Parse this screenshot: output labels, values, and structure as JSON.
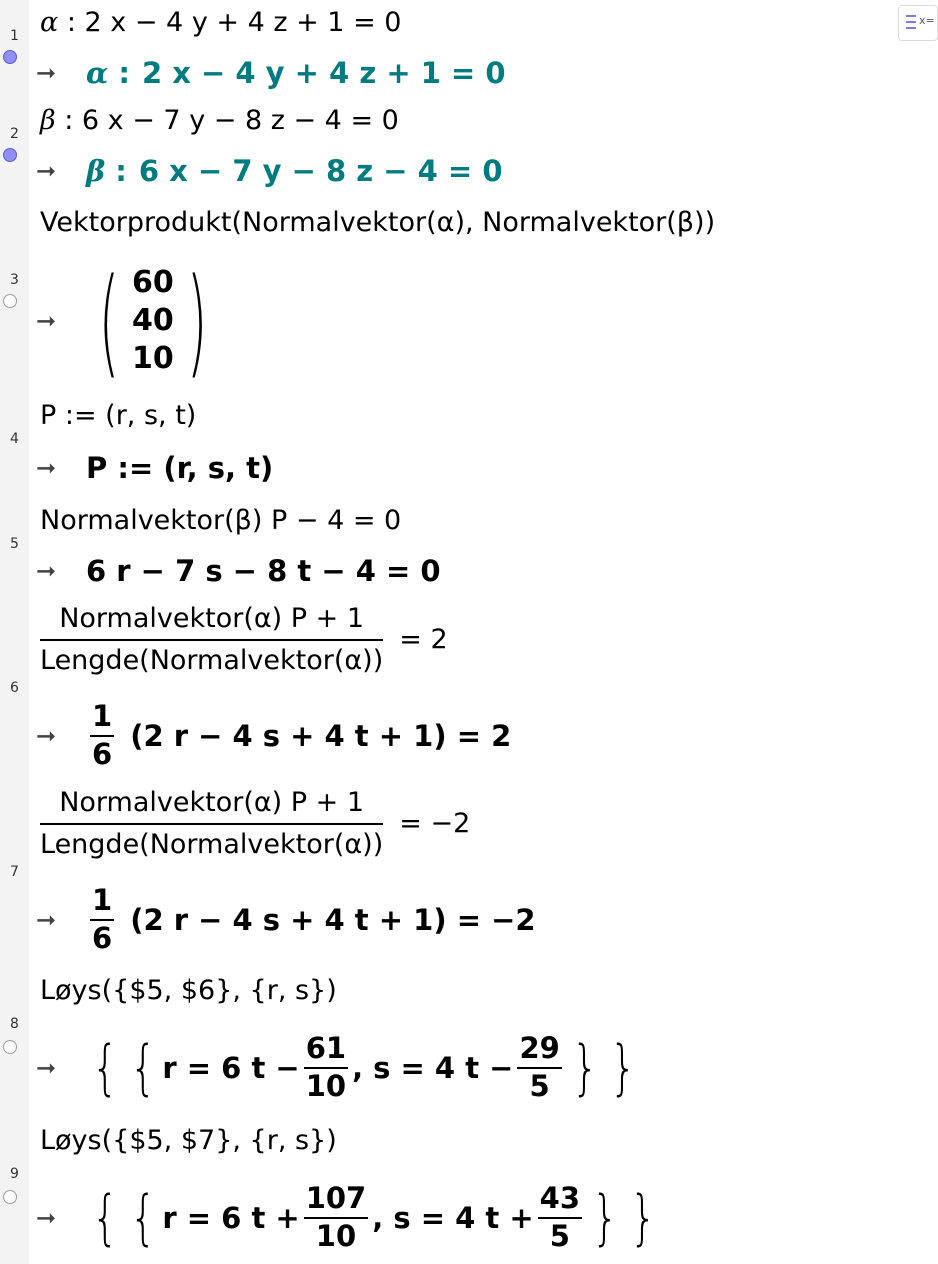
{
  "rows": [
    {
      "num": "1",
      "input": {
        "name": "α",
        "expr": "2 x − 4 y + 4 z + 1  =  0"
      },
      "output": {
        "name": "α",
        "expr": "2 x − 4 y + 4 z + 1 = 0"
      }
    },
    {
      "num": "2",
      "input": {
        "name": "β",
        "expr": "6 x − 7 y − 8 z − 4  =  0"
      },
      "output": {
        "name": "β",
        "expr": "6 x − 7 y − 8 z − 4 = 0"
      }
    },
    {
      "num": "3",
      "input": "Vektorprodukt(Normalvektor(α), Normalvektor(β))",
      "output": {
        "vector": [
          "60",
          "40",
          "10"
        ]
      }
    },
    {
      "num": "4",
      "input": "P := (r, s, t)",
      "output": "P  :=  (r, s, t)"
    },
    {
      "num": "5",
      "input": "Normalvektor(β) P − 4  =  0",
      "output": "6 r − 7 s − 8 t − 4 = 0"
    },
    {
      "num": "6",
      "input": {
        "numerator": "Normalvektor(α) P + 1",
        "denominator": "Lengde(Normalvektor(α))",
        "rhs": "=  2"
      },
      "output": {
        "fnum": "1",
        "fden": "6",
        "rest": "(2 r − 4 s + 4 t + 1) = 2"
      }
    },
    {
      "num": "7",
      "input": {
        "numerator": "Normalvektor(α) P + 1",
        "denominator": "Lengde(Normalvektor(α))",
        "rhs": "=  −2"
      },
      "output": {
        "fnum": "1",
        "fden": "6",
        "rest": "(2 r − 4 s + 4 t + 1) = −2"
      }
    },
    {
      "num": "8",
      "input": "Løys({$5, $6}, {r, s})",
      "output": {
        "r_pre": "r = 6 t −",
        "r_num": "61",
        "r_den": "10",
        "s_pre": ", s = 4 t −",
        "s_num": "29",
        "s_den": "5"
      }
    },
    {
      "num": "9",
      "input": "Løys({$5, $7}, {r, s})",
      "output": {
        "r_pre": "r = 6 t +",
        "r_num": "107",
        "r_den": "10",
        "s_pre": ", s = 4 t +",
        "s_num": "43",
        "s_den": "5"
      }
    }
  ],
  "arrow_symbol": "➞",
  "colon": ":",
  "brace_open": "{",
  "brace_close": "}",
  "paren_open": "(",
  "paren_close": ")",
  "stylebar_label": "x=",
  "colors": {
    "teal": "#007b80",
    "marker_on": "#8f8ff5",
    "gutter": "#f3f3f3"
  }
}
